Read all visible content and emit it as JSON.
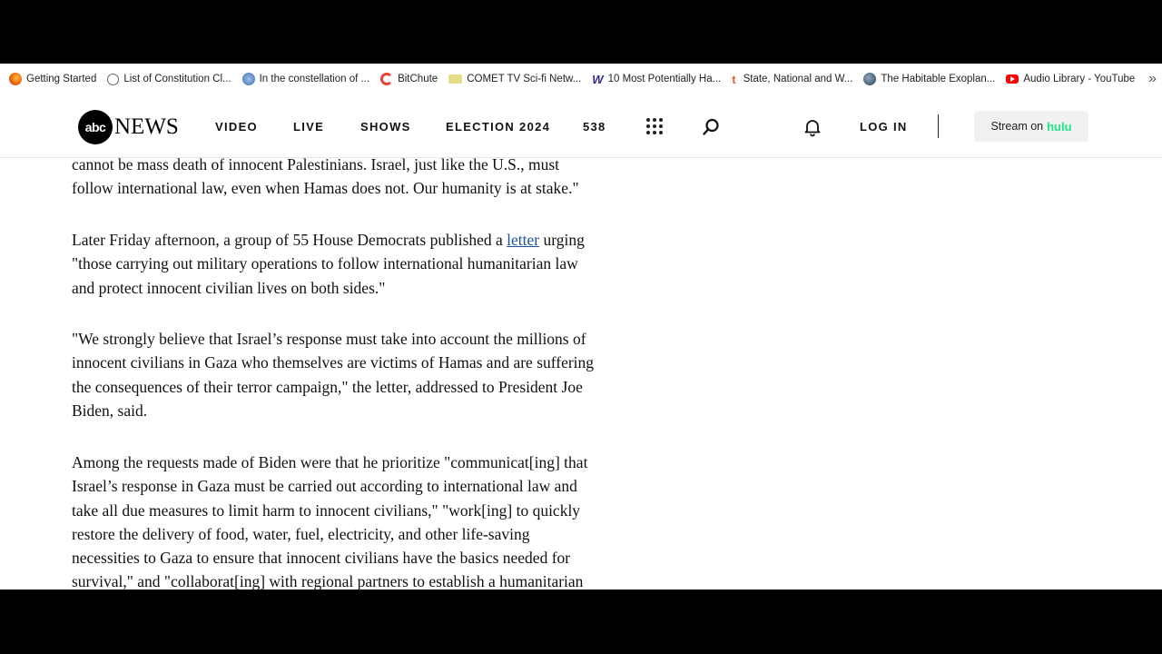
{
  "bookmarks": [
    {
      "label": "Getting Started",
      "icon": "firefox-icon",
      "color": "#e66000"
    },
    {
      "label": "List of Constitution Cl...",
      "icon": "globe-icon",
      "color": "#666666"
    },
    {
      "label": "In the constellation of ...",
      "icon": "globe-icon",
      "color": "#3a6fb0"
    },
    {
      "label": "BitChute",
      "icon": "bitchute-icon",
      "color": "#ef4137"
    },
    {
      "label": "COMET TV Sci-fi Netw...",
      "icon": "folder-icon",
      "color": "#c7c26a"
    },
    {
      "label": "10 Most Potentially Ha...",
      "icon": "w-icon",
      "color": "#2b2b8f"
    },
    {
      "label": "State, National and W...",
      "icon": "t-icon",
      "color": "#e85d2a"
    },
    {
      "label": "The Habitable Exoplan...",
      "icon": "planet-icon",
      "color": "#2c3e50"
    },
    {
      "label": "Audio Library - YouTube",
      "icon": "youtube-icon",
      "color": "#ff0000"
    }
  ],
  "more_glyph": "»",
  "header": {
    "logo_abc": "abc",
    "logo_news": "NEWS",
    "nav": [
      "VIDEO",
      "LIVE",
      "SHOWS",
      "ELECTION 2024",
      "538"
    ],
    "login": "LOG IN",
    "stream_text": "Stream on",
    "stream_brand": "hulu"
  },
  "article": {
    "p1": [
      "cannot be mass death of innocent Palestinians. Israel, just like the U.S., must",
      "follow international law, even when Hamas does not. Our humanity is at stake.\""
    ],
    "p2_line1_before": "Later Friday afternoon, a group of 55 House Democrats published a ",
    "p2_link": "letter",
    "p2_line1_after": " urging",
    "p2_rest": [
      "\"those carrying out military operations to follow international humanitarian law",
      "and protect innocent civilian lives on both sides.\""
    ],
    "p3": [
      "\"We strongly believe that Israel’s response must take into account the millions of",
      "innocent civilians in Gaza who themselves are victims of Hamas and are suffering",
      "the consequences of their terror campaign,\" the letter, addressed to President Joe",
      "Biden, said."
    ],
    "p4": [
      "Among the requests made of Biden were that he prioritize \"communicat[ing] that",
      "Israel’s response in Gaza must be carried out according to international law and",
      "take all due measures to limit harm to innocent civilians,\" \"work[ing] to quickly",
      "restore the delivery of food, water, fuel, electricity, and other life-saving",
      "necessities to Gaza to ensure that innocent civilians have the basics needed for",
      "survival,\" and \"collaborat[ing] with regional partners to establish a humanitarian"
    ]
  }
}
